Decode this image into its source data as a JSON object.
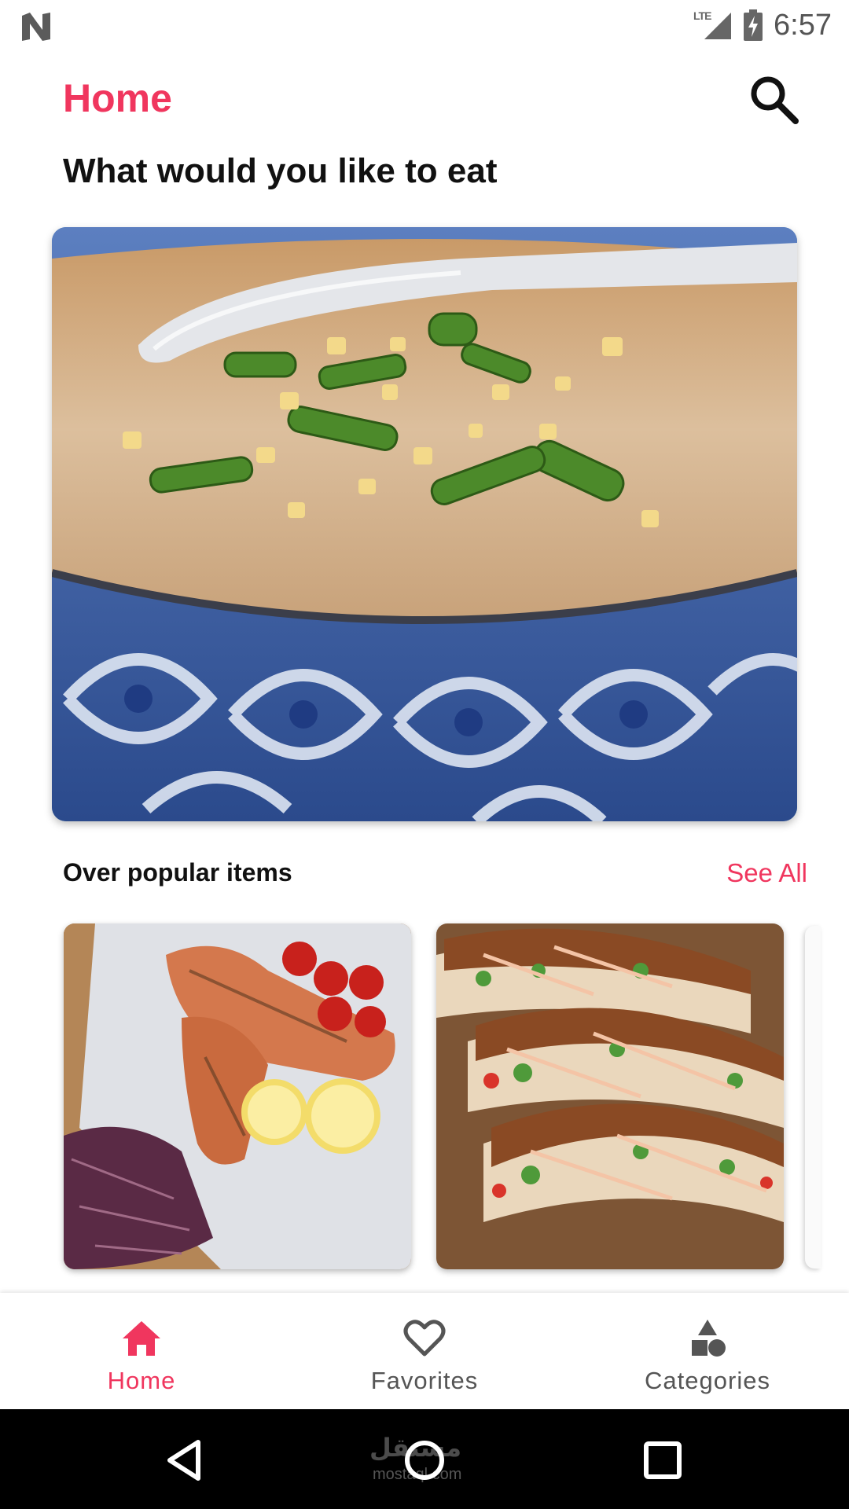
{
  "status_bar": {
    "network": "LTE",
    "time": "6:57"
  },
  "header": {
    "title": "Home",
    "search_icon": "search-icon"
  },
  "headline": "What would you like to eat",
  "hero": {
    "icon": "congee-bowl-image"
  },
  "popular": {
    "title": "Over popular items",
    "see_all": "See All",
    "items": [
      {
        "image": "grilled-salmon-lemon-image"
      },
      {
        "image": "fish-tacos-image"
      }
    ]
  },
  "bottom_nav": {
    "items": [
      {
        "label": "Home",
        "icon": "home-icon",
        "active": true
      },
      {
        "label": "Favorites",
        "icon": "heart-icon",
        "active": false
      },
      {
        "label": "Categories",
        "icon": "shapes-icon",
        "active": false
      }
    ]
  },
  "system_nav": {
    "watermark": "مستقل",
    "watermark_sub": "mostaql.com"
  },
  "colors": {
    "accent": "#f0365e",
    "text": "#111111",
    "muted": "#555555"
  }
}
